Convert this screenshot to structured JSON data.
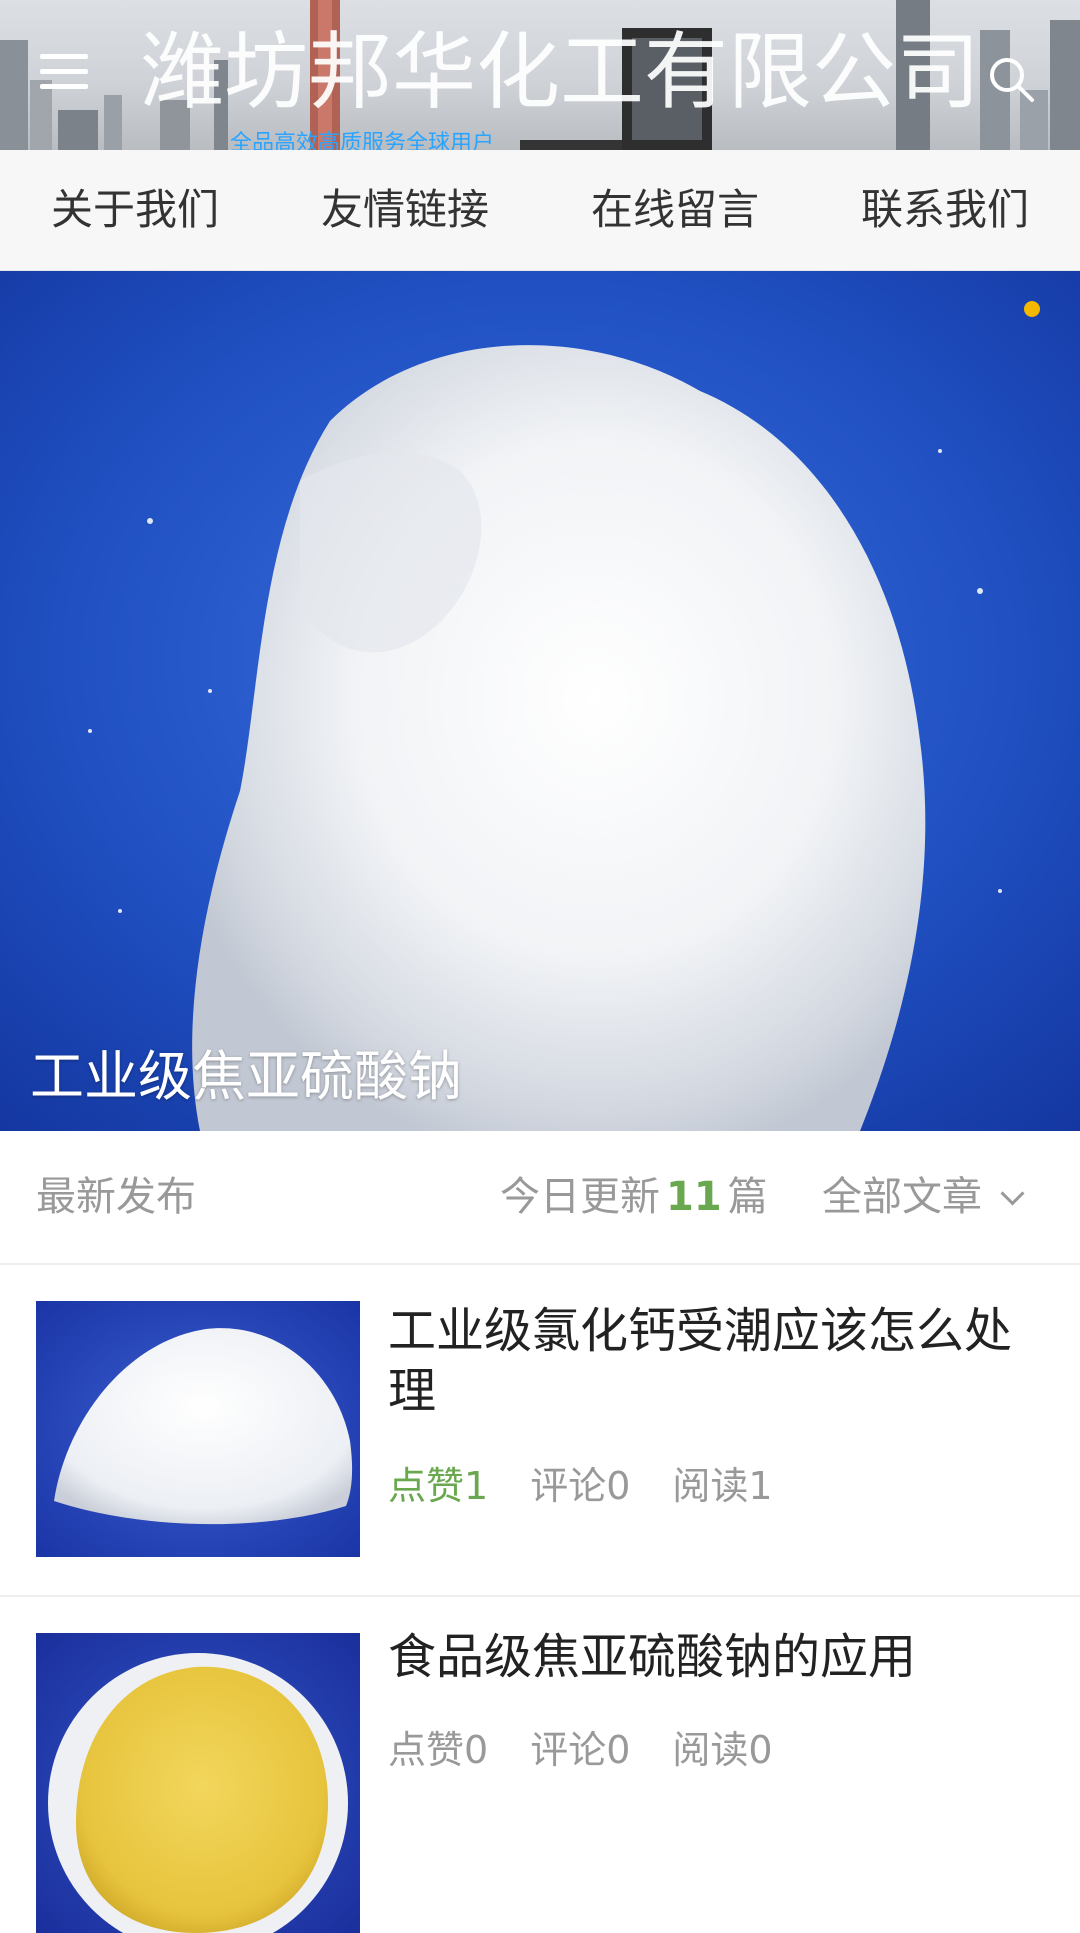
{
  "header": {
    "site_title": "潍坊邦华化工有限公司",
    "banner_tagline": "全品高效高质服务全球用户"
  },
  "nav": {
    "items": [
      {
        "label": "关于我们"
      },
      {
        "label": "友情链接"
      },
      {
        "label": "在线留言"
      },
      {
        "label": "联系我们"
      }
    ]
  },
  "slider": {
    "caption": "工业级焦亚硫酸钠",
    "dot_color": "#f5b800"
  },
  "section": {
    "title": "最新发布",
    "today_prefix": "今日更新",
    "today_count": "11",
    "today_suffix": "篇",
    "all_articles_label": "全部文章"
  },
  "articles": [
    {
      "title": "工业级氯化钙受潮应该怎么处理",
      "likes": "点赞1",
      "comments": "评论0",
      "reads": "阅读1"
    },
    {
      "title": "食品级焦亚硫酸钠的应用",
      "likes": "点赞0",
      "comments": "评论0",
      "reads": "阅读0"
    }
  ],
  "colors": {
    "accent_green": "#6aa84f",
    "slide_blue": "#1f4fc0"
  }
}
